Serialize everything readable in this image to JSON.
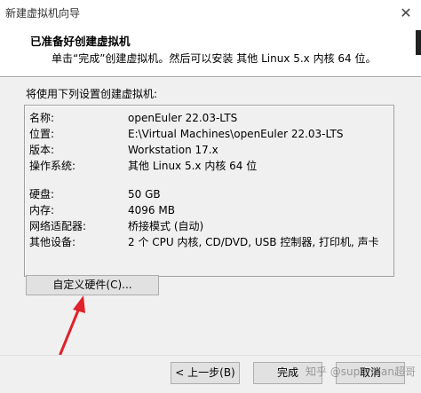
{
  "window": {
    "title": "新建虚拟机向导",
    "close_glyph": "✕"
  },
  "header": {
    "title": "已准备好创建虚拟机",
    "subtitle": "单击“完成”创建虚拟机。然后可以安装 其他 Linux 5.x 内核 64 位。"
  },
  "content": {
    "section_label": "将使用下列设置创建虚拟机:",
    "settings": [
      {
        "key": "名称:",
        "value": "openEuler 22.03-LTS"
      },
      {
        "key": "位置:",
        "value": "E:\\Virtual Machines\\openEuler 22.03-LTS"
      },
      {
        "key": "版本:",
        "value": "Workstation 17.x"
      },
      {
        "key": "操作系统:",
        "value": "其他 Linux 5.x 内核 64 位"
      },
      {
        "key": "硬盘:",
        "value": "50 GB"
      },
      {
        "key": "内存:",
        "value": "4096 MB"
      },
      {
        "key": "网络适配器:",
        "value": "桥接模式 (自动)"
      },
      {
        "key": "其他设备:",
        "value": "2 个 CPU 内核, CD/DVD, USB 控制器, 打印机, 声卡"
      }
    ],
    "customize_button": "自定义硬件(C)..."
  },
  "footer": {
    "back_button": "< 上一步(B)",
    "finish_button": "完成",
    "cancel_button": "取消"
  },
  "watermark": "知乎 @superman超哥",
  "colors": {
    "annotation_arrow": "#e0202a"
  }
}
